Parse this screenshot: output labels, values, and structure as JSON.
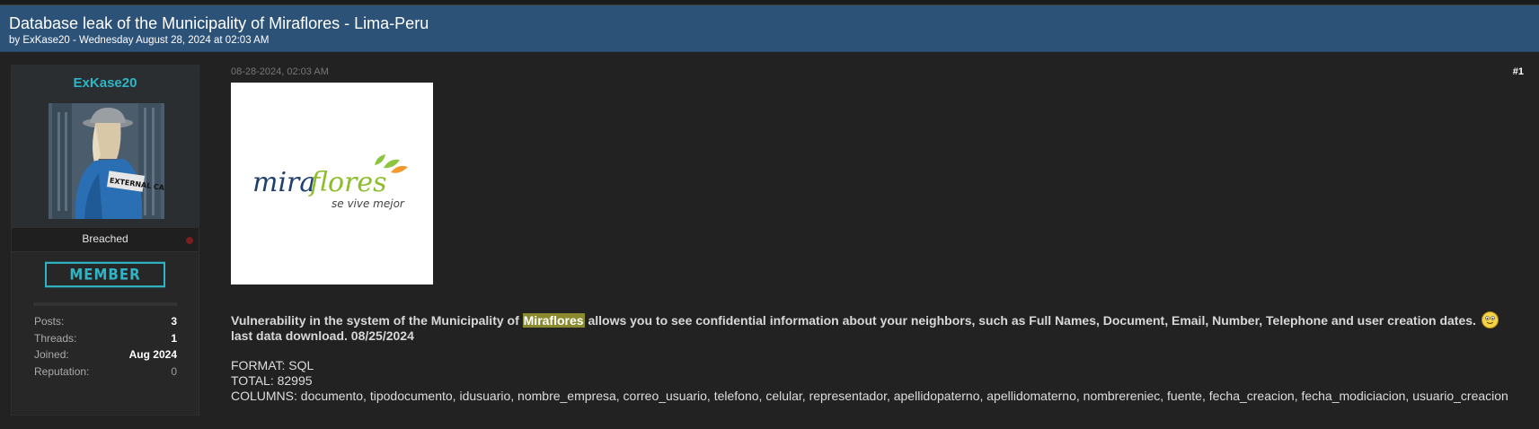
{
  "thread": {
    "title": "Database leak of the Municipality of Miraflores - Lima-Peru",
    "meta": "by ExKase20 - Wednesday August 28, 2024 at 02:03 AM"
  },
  "author": {
    "username": "ExKase20",
    "avatar_icon": "avatar-image",
    "avatar_text": "EXTERNAL CASE",
    "group": "Breached",
    "badge": "MEMBER",
    "stats": [
      {
        "label": "Posts:",
        "value": "3"
      },
      {
        "label": "Threads:",
        "value": "1"
      },
      {
        "label": "Joined:",
        "value": "Aug 2024"
      },
      {
        "label": "Reputation:",
        "value": "0"
      }
    ]
  },
  "post": {
    "date": "08-28-2024, 02:03 AM",
    "number": "#1",
    "logo": {
      "brand": "miraflores",
      "tagline": "se vive mejor"
    },
    "line1_before": "Vulnerability in the system of the Municipality of ",
    "line1_highlight": "Miraflores",
    "line1_after": " allows you to see confidential information about your neighbors, such as Full Names, Document, Email, Number, Telephone and user creation dates.",
    "smiley_icon": "smiley-icon",
    "line2": "last data download. 08/25/2024",
    "format": "FORMAT: SQL",
    "total": "TOTAL: 82995",
    "columns": "COLUMNS: documento, tipodocumento, idusuario, nombre_empresa, correo_usuario, telefono, celular, representador, apellidopaterno, apellidomaterno, nombrereniec, fuente, fecha_creacion, fecha_modiciacion, usuario_creacion"
  },
  "colors": {
    "header_bg": "#2d5278",
    "accent": "#2fb5c6",
    "highlight": "#8a8b2e",
    "status_offline": "#7a1e1e"
  }
}
